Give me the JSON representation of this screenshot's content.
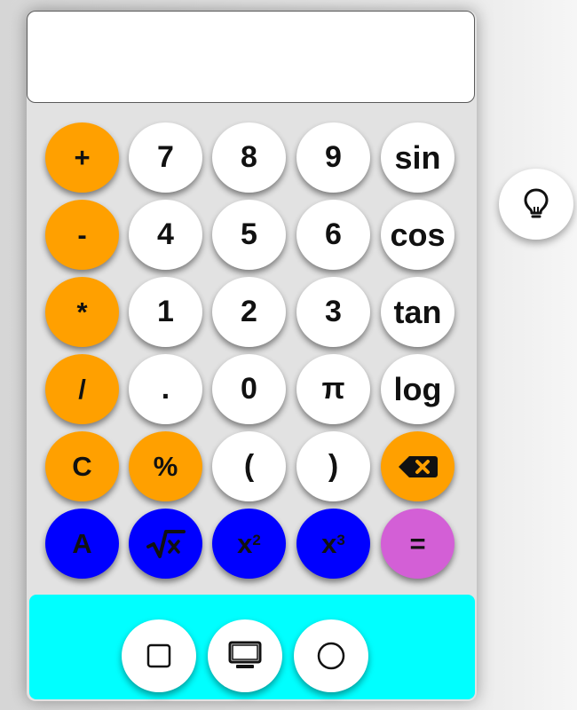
{
  "display": {
    "value": ""
  },
  "buttons": {
    "plus": "+",
    "seven": "7",
    "eight": "8",
    "nine": "9",
    "sin": "sin",
    "minus": "-",
    "four": "4",
    "five": "5",
    "six": "6",
    "cos": "cos",
    "multiply": "*",
    "one": "1",
    "two": "2",
    "three": "3",
    "tan": "tan",
    "divide": "/",
    "decimal": ".",
    "zero": "0",
    "pi": "π",
    "log": "log",
    "clear": "C",
    "percent": "%",
    "open_paren": "(",
    "close_paren": ")",
    "answer": "A",
    "square_base": "x",
    "square_exp": "2",
    "cube_base": "x",
    "cube_exp": "3",
    "equals": "="
  },
  "footer": {
    "icons": [
      "square-icon",
      "monitor-icon",
      "circle-icon"
    ]
  },
  "colors": {
    "operator": "#ffa000",
    "number": "#ffffff",
    "function": "#0000ff",
    "equals": "#d35fd6",
    "footer": "#00ffff"
  }
}
